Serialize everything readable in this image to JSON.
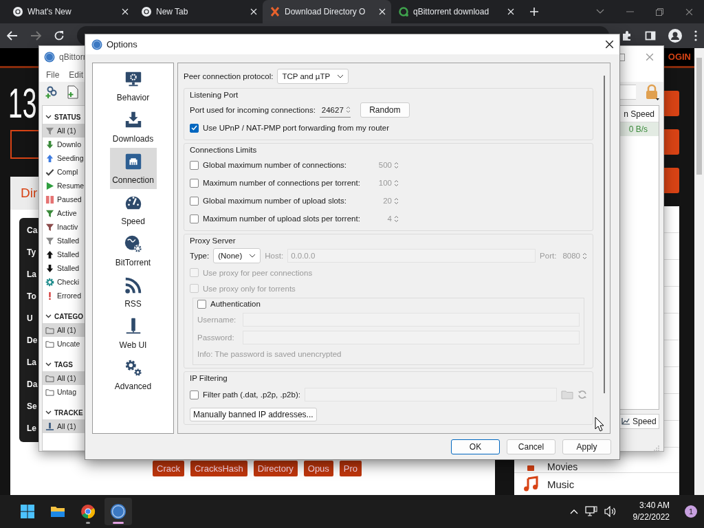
{
  "browser": {
    "tabs": [
      {
        "kind": "browser",
        "title": "What's New",
        "selected": false
      },
      {
        "kind": "site",
        "title": "New Tab",
        "selected": false
      },
      {
        "kind": "site_x",
        "title": "Download Directory O",
        "selected": true
      },
      {
        "kind": "ring",
        "title": "qBittorrent download",
        "selected": false
      }
    ],
    "page": {
      "login": "OGIN",
      "big_number": "13",
      "heading": "Dir",
      "info_labels": [
        "Ca",
        "Ty",
        "La",
        "To",
        "U",
        "De",
        "La",
        "Da",
        "Se",
        "Le"
      ],
      "tags": [
        "Crack",
        "CracksHash",
        "Directory",
        "Opus",
        "Pro"
      ],
      "categories": [
        {
          "kind": "movies",
          "label": "Movies"
        },
        {
          "kind": "music",
          "label": "Music"
        }
      ]
    }
  },
  "qbittorrent_window": {
    "title": "qBittorr",
    "menu": [
      "File",
      "Edit"
    ],
    "sidebar": [
      {
        "title": "STATUS",
        "items": [
          {
            "kind": "all",
            "label": "All (1)",
            "selected": true
          },
          {
            "kind": "downloading",
            "label": "Downlo",
            "selected": false
          },
          {
            "kind": "seeding",
            "label": "Seeding",
            "selected": false
          },
          {
            "kind": "completed",
            "label": "Compl",
            "selected": false
          },
          {
            "kind": "resumed",
            "label": "Resume",
            "selected": false
          },
          {
            "kind": "paused",
            "label": "Paused",
            "selected": false
          },
          {
            "kind": "active",
            "label": "Active",
            "selected": false
          },
          {
            "kind": "inactive",
            "label": "Inactiv",
            "selected": false
          },
          {
            "kind": "stalled",
            "label": "Stalled",
            "selected": false
          },
          {
            "kind": "stalled_up",
            "label": "Stalled",
            "selected": false
          },
          {
            "kind": "stalled_down",
            "label": "Stalled",
            "selected": false
          },
          {
            "kind": "checking",
            "label": "Checki",
            "selected": false
          },
          {
            "kind": "errored",
            "label": "Errored",
            "selected": false
          }
        ]
      },
      {
        "title": "CATEGO",
        "items": [
          {
            "kind": "folder",
            "label": "All (1)",
            "selected": true
          },
          {
            "kind": "folder",
            "label": "Uncate",
            "selected": false
          }
        ]
      },
      {
        "title": "TAGS",
        "items": [
          {
            "kind": "folder",
            "label": "All (1)",
            "selected": true
          },
          {
            "kind": "folder",
            "label": "Untag",
            "selected": false
          }
        ]
      },
      {
        "title": "TRACKE",
        "items": [
          {
            "kind": "tracker",
            "label": "All (1)",
            "selected": true
          }
        ]
      }
    ],
    "table": {
      "column": "n Speed",
      "rows": [
        {
          "value": "0 B/s",
          "selected": true
        }
      ]
    },
    "speed_button": "Speed"
  },
  "options_dialog": {
    "title": "Options",
    "sections": [
      {
        "kind": "behavior",
        "label": "Behavior",
        "selected": false
      },
      {
        "kind": "downloads",
        "label": "Downloads",
        "selected": false
      },
      {
        "kind": "connection",
        "label": "Connection",
        "selected": true
      },
      {
        "kind": "speed",
        "label": "Speed",
        "selected": false
      },
      {
        "kind": "bittorrent",
        "label": "BitTorrent",
        "selected": false
      },
      {
        "kind": "rss",
        "label": "RSS",
        "selected": false
      },
      {
        "kind": "webui",
        "label": "Web UI",
        "selected": false
      },
      {
        "kind": "advanced",
        "label": "Advanced",
        "selected": false
      }
    ],
    "protocol": {
      "label": "Peer connection protocol:",
      "value": "TCP and µTP"
    },
    "listening_port": {
      "title": "Listening Port",
      "port_label": "Port used for incoming connections:",
      "port": "24627",
      "random_button": "Random",
      "upnp": {
        "label": "Use UPnP / NAT-PMP port forwarding from my router",
        "checked": true
      }
    },
    "connection_limits": {
      "title": "Connections Limits",
      "rows": [
        {
          "label": "Global maximum number of connections:",
          "checked": false,
          "value": "500"
        },
        {
          "label": "Maximum number of connections per torrent:",
          "checked": false,
          "value": "100"
        },
        {
          "label": "Global maximum number of upload slots:",
          "checked": false,
          "value": "20"
        },
        {
          "label": "Maximum number of upload slots per torrent:",
          "checked": false,
          "value": "4"
        }
      ]
    },
    "proxy": {
      "title": "Proxy Server",
      "disabled": true,
      "type_label": "Type:",
      "type": "(None)",
      "host_label": "Host:",
      "host": "0.0.0.0",
      "port_label": "Port:",
      "port": "8080",
      "options": [
        {
          "label": "Use proxy for peer connections",
          "checked": false
        },
        {
          "label": "Use proxy only for torrents",
          "checked": false
        }
      ],
      "authentication": {
        "label": "Authentication",
        "checked": false,
        "username_label": "Username:",
        "password_label": "Password:",
        "info": "Info: The password is saved unencrypted"
      }
    },
    "ip_filtering": {
      "title": "IP Filtering",
      "filter": {
        "label": "Filter path (.dat, .p2p, .p2b):",
        "checked": false
      },
      "banned_button": "Manually banned IP addresses..."
    },
    "buttons": [
      {
        "label": "OK",
        "default": true
      },
      {
        "label": "Cancel",
        "default": false
      },
      {
        "label": "Apply",
        "default": false
      }
    ]
  },
  "taskbar": {
    "apps": [
      {
        "kind": "start",
        "running": false,
        "selected": false
      },
      {
        "kind": "explorer",
        "running": false,
        "selected": false
      },
      {
        "kind": "browser",
        "running": true,
        "selected": false
      },
      {
        "kind": "qbittorrent",
        "running": true,
        "selected": true
      }
    ],
    "time": "3:40 AM",
    "date": "9/22/2022",
    "notifications": "1"
  }
}
